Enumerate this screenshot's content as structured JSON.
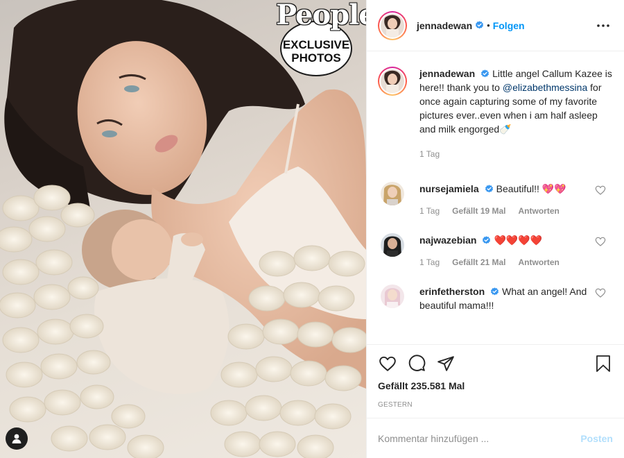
{
  "badge": {
    "brand": "People",
    "lines": [
      "EXCLUSIVE",
      "PHOTOS"
    ]
  },
  "photo": {
    "icons": {
      "user_tag": "user-tag-icon"
    }
  },
  "header": {
    "username": "jennadewan",
    "separator": "•",
    "follow_label": "Folgen",
    "icons": {
      "verified": "verified-badge-icon",
      "more": "more-options-icon"
    }
  },
  "caption": {
    "username": "jennadewan",
    "text_before": "Little angel Callum Kazee is here!! thank you to ",
    "mention": "@elizabethmessina",
    "text_after": " for once again capturing some of my favorite pictures ever..even when i am half asleep and milk engorged",
    "emoji": "🍼",
    "time": "1 Tag"
  },
  "comments": [
    {
      "username": "nursejamiela",
      "text": "Beautiful!! ",
      "emoji": "💖💖",
      "time": "1 Tag",
      "likes": "Gefällt 19 Mal",
      "reply": "Antworten",
      "avatar_color": "#c9a46a"
    },
    {
      "username": "najwazebian",
      "text": "",
      "emoji": "❤️❤️❤️❤️",
      "time": "1 Tag",
      "likes": "Gefällt 21 Mal",
      "reply": "Antworten",
      "avatar_color": "#3a3a3a"
    },
    {
      "username": "erinfetherston",
      "text": "What an angel! And beautiful mama!!!",
      "emoji": "",
      "avatar_color": "#e9c9d2"
    }
  ],
  "actions": {
    "icons": [
      "heart-icon",
      "comment-icon",
      "share-icon",
      "bookmark-icon"
    ],
    "likes": "Gefällt 235.581 Mal",
    "posted": "GESTERN"
  },
  "composer": {
    "placeholder": "Kommentar hinzufügen ...",
    "post_label": "Posten"
  },
  "colors": {
    "accent_blue": "#0095f6",
    "mention_blue": "#00376b",
    "post_disabled": "#b2dffc",
    "heart_red": "#ed4956"
  }
}
